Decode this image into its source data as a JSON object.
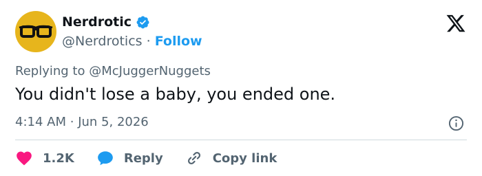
{
  "tweet": {
    "author": {
      "name": "Nerdrotic",
      "handle": "@Nerdrotics",
      "separator": "·",
      "follow_label": "Follow",
      "verified_icon": "verified-badge-icon",
      "avatar_icon": "glasses-avatar-icon"
    },
    "reply_prefix": "Replying to",
    "reply_handle": "@McJuggerNuggets",
    "text": "You didn't lose a baby, you ended one.",
    "time": "4:14 AM",
    "date_separator": "·",
    "date": "Jun 5, 2026",
    "actions": {
      "likes_count": "1.2K",
      "reply_label": "Reply",
      "copy_link_label": "Copy link"
    }
  },
  "colors": {
    "text_primary": "#0f1419",
    "text_secondary": "#536471",
    "accent": "#1d9bf0",
    "heart": "#f91880",
    "avatar_bg": "#e7b51c",
    "divider": "#cfd9de"
  }
}
